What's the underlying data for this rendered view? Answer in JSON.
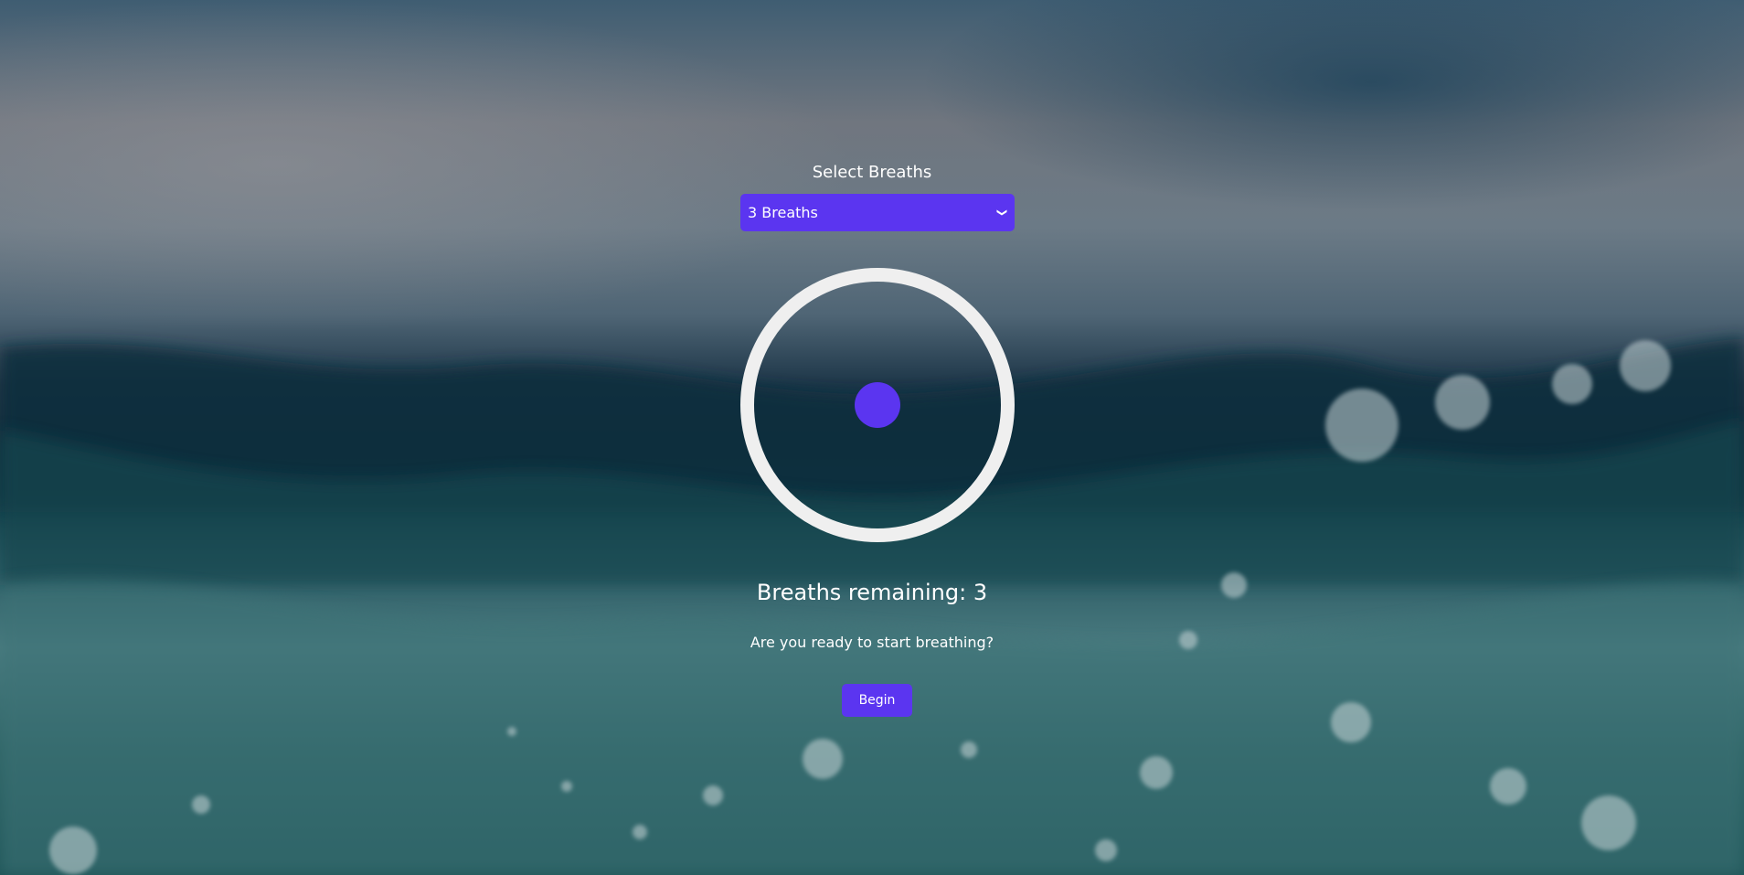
{
  "selector": {
    "label": "Select Breaths",
    "selected": "3 Breaths",
    "chevron_icon": "chevron-down-icon"
  },
  "status": {
    "remaining": "Breaths remaining: 3",
    "prompt": "Are you ready to start breathing?"
  },
  "actions": {
    "begin_label": "Begin"
  },
  "colors": {
    "accent": "#5b35f0",
    "ring": "#efefef",
    "text": "#ffffff"
  }
}
